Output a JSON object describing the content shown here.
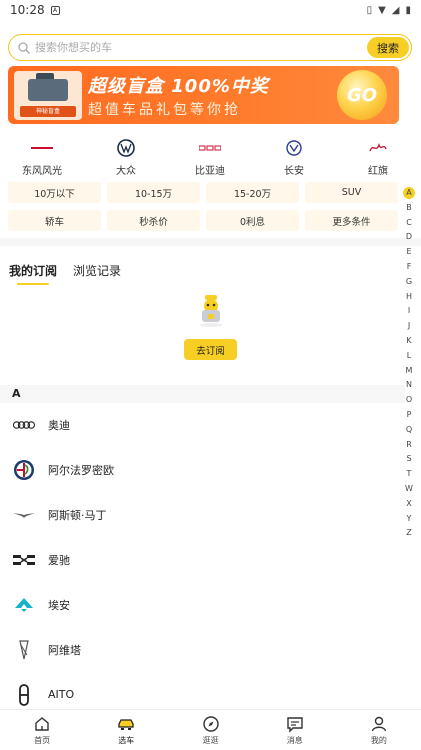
{
  "status_bar": {
    "time": "10:28"
  },
  "search": {
    "placeholder": "搜索你想买的车",
    "button": "搜索"
  },
  "banner": {
    "title": "超级盲盒 100%中奖",
    "subtitle": "超值车品礼包等你抢",
    "badge": "GO",
    "product_tag": "神秘盲盒"
  },
  "brands": [
    {
      "name": "东风风光",
      "icon": "dongfeng-logo"
    },
    {
      "name": "大众",
      "icon": "vw-logo"
    },
    {
      "name": "比亚迪",
      "icon": "byd-logo"
    },
    {
      "name": "长安",
      "icon": "changan-logo"
    },
    {
      "name": "红旗",
      "icon": "hongqi-logo"
    }
  ],
  "filters": [
    "10万以下",
    "10-15万",
    "15-20万",
    "SUV",
    "轿车",
    "秒杀价",
    "0利息",
    "更多条件"
  ],
  "tabs": {
    "subscriptions": "我的订阅",
    "history": "浏览记录"
  },
  "subscribe_button": "去订阅",
  "section_letter": "A",
  "brand_list": [
    {
      "name": "奥迪",
      "icon": "audi-logo"
    },
    {
      "name": "阿尔法罗密欧",
      "icon": "alfa-romeo-logo"
    },
    {
      "name": "阿斯顿·马丁",
      "icon": "aston-martin-logo"
    },
    {
      "name": "爱驰",
      "icon": "aiways-logo"
    },
    {
      "name": "埃安",
      "icon": "aion-logo"
    },
    {
      "name": "阿维塔",
      "icon": "avatr-logo"
    },
    {
      "name": "AITO",
      "icon": "aito-logo"
    }
  ],
  "alpha_index": [
    "A",
    "B",
    "C",
    "D",
    "E",
    "F",
    "G",
    "H",
    "I",
    "J",
    "K",
    "L",
    "M",
    "N",
    "O",
    "P",
    "Q",
    "R",
    "S",
    "T",
    "W",
    "X",
    "Y",
    "Z"
  ],
  "bottom_nav": [
    {
      "label": "首页",
      "icon": "home-icon"
    },
    {
      "label": "选车",
      "icon": "car-icon"
    },
    {
      "label": "逛逛",
      "icon": "compass-icon"
    },
    {
      "label": "消息",
      "icon": "message-icon"
    },
    {
      "label": "我的",
      "icon": "user-icon"
    }
  ],
  "colors": {
    "accent": "#f7cf24",
    "banner": "#ff6a1f",
    "chip_bg": "#fff8ea"
  }
}
